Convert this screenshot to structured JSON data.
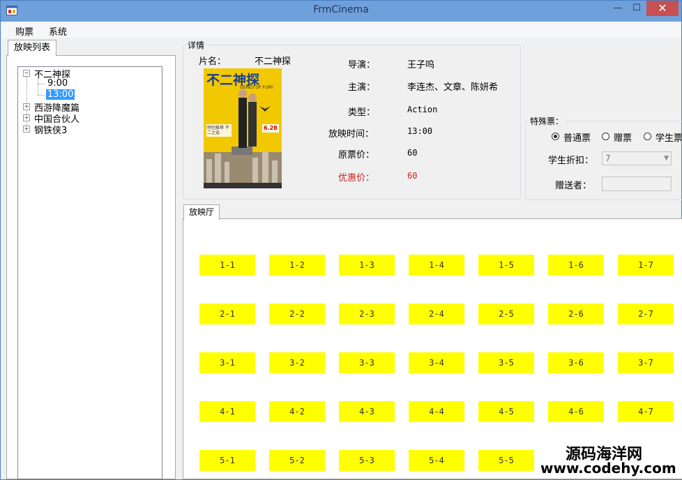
{
  "window": {
    "title": "FrmCinema",
    "min_glyph": "—",
    "max_glyph": "☐",
    "close_glyph": "✕"
  },
  "menu": [
    "购票",
    "系统"
  ],
  "left_tab": "放映列表",
  "tree": [
    {
      "label": "不二神探",
      "expanded": true,
      "children": [
        "9:00",
        "13:00"
      ],
      "selected": "13:00"
    },
    {
      "label": "西游降魔篇",
      "expanded": false
    },
    {
      "label": "中国合伙人",
      "expanded": false
    },
    {
      "label": "钢铁侠3",
      "expanded": false
    }
  ],
  "details": {
    "group_title": "详情",
    "name_label": "片名：",
    "name": "不二神探",
    "director_label": "导演：",
    "director": "王子呜",
    "actors_label": "主演：",
    "actors": "李连杰、文章、陈妍希",
    "type_label": "类型：",
    "type": "Action",
    "time_label": "放映时间：",
    "time": "13:00",
    "price_label": "原票价：",
    "price": "60",
    "discount_label": "优惠价：",
    "discount": "60",
    "poster": {
      "title": "不二神探",
      "subtitle": "GENES OF FURY",
      "date": "6.28",
      "tag": "特别推荐 不二之选"
    }
  },
  "special": {
    "group_title": "特殊票：",
    "options": [
      "普通票",
      "赠票",
      "学生票"
    ],
    "selected": 0,
    "student_discount_label": "学生折扣：",
    "student_discount_value": "7",
    "giver_label": "赠送者：",
    "giver_value": ""
  },
  "hall": {
    "tab": "放映厅",
    "rows": [
      [
        "1-1",
        "1-2",
        "1-3",
        "1-4",
        "1-5",
        "1-6",
        "1-7"
      ],
      [
        "2-1",
        "2-2",
        "2-3",
        "2-4",
        "2-5",
        "2-6",
        "2-7"
      ],
      [
        "3-1",
        "3-2",
        "3-3",
        "3-4",
        "3-5",
        "3-6",
        "3-7"
      ],
      [
        "4-1",
        "4-2",
        "4-3",
        "4-4",
        "4-5",
        "4-6",
        "4-7"
      ],
      [
        "5-1",
        "5-2",
        "5-3",
        "5-4",
        "5-5",
        "",
        ""
      ]
    ],
    "seat_color": "#ffff00"
  },
  "watermark": {
    "text": "源码海洋网",
    "url": "www.codehy.com"
  }
}
